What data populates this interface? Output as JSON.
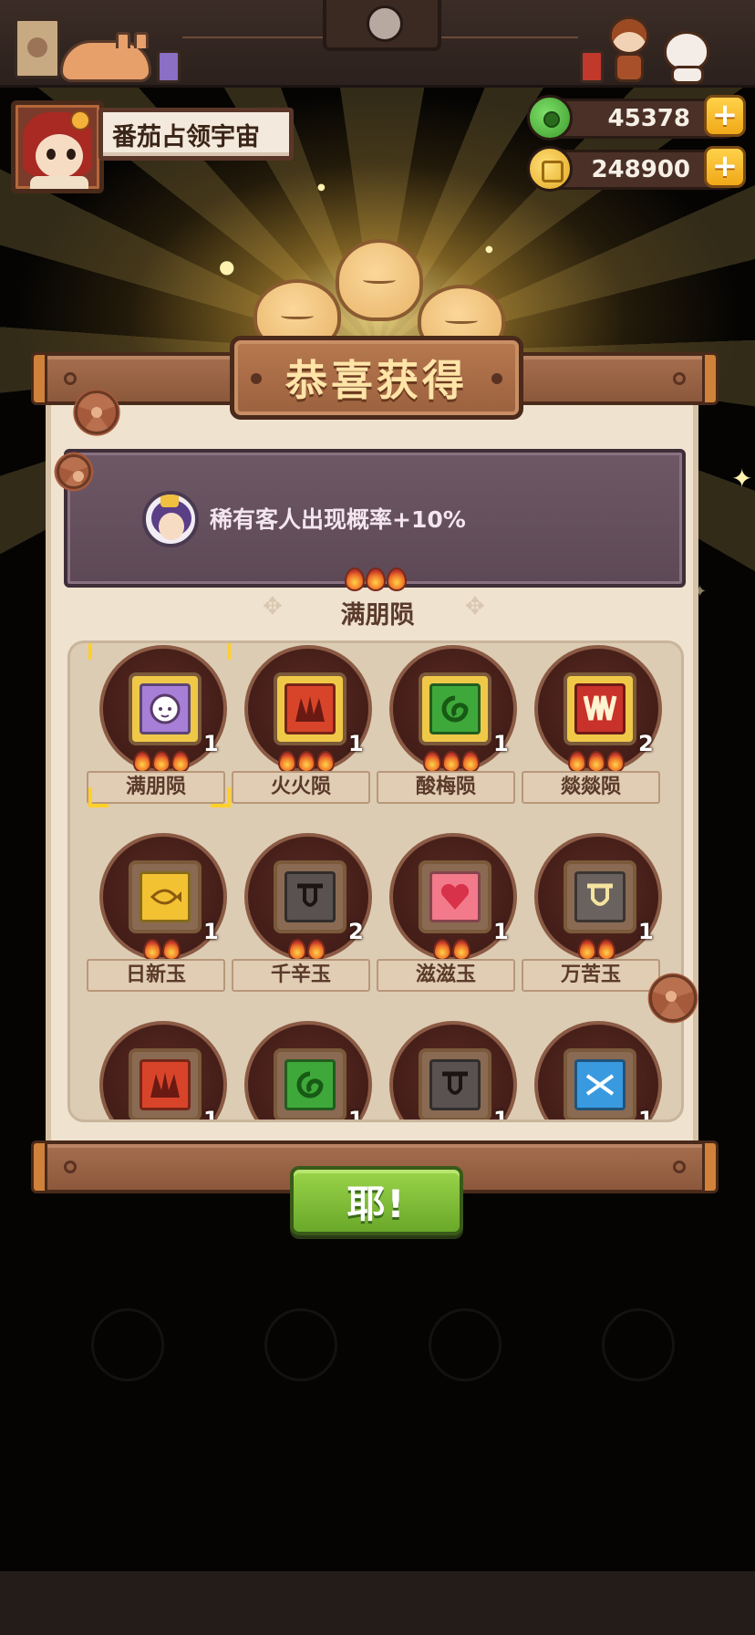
{
  "header": {
    "player_name": "番茄占领宇宙"
  },
  "currency": {
    "jade": "45378",
    "gold": "248900",
    "add_symbol": "+"
  },
  "popup": {
    "title": "恭喜获得",
    "bonus_text": "稀有客人出现概率+10%",
    "bonus_fire_count": 3,
    "set_name": "满朋陨",
    "confirm_label": "耶!"
  },
  "items": [
    {
      "name": "满朋陨",
      "count": "1",
      "fires": 3,
      "color": "#a77fd6",
      "tile": "#f0c848",
      "icon": "sheep-icon",
      "glyph": "",
      "selected": true
    },
    {
      "name": "火火陨",
      "count": "1",
      "fires": 3,
      "color": "#d8442a",
      "tile": "#f0c848",
      "icon": "flame-icon",
      "glyph": "",
      "selected": false
    },
    {
      "name": "酸梅陨",
      "count": "1",
      "fires": 3,
      "color": "#3fa83a",
      "tile": "#f0c848",
      "icon": "swirl-icon",
      "glyph": "",
      "selected": false
    },
    {
      "name": "燚燚陨",
      "count": "2",
      "fires": 3,
      "color": "#c8322a",
      "tile": "#f0c848",
      "icon": "crown-icon",
      "glyph": "",
      "selected": false
    },
    {
      "name": "日新玉",
      "count": "1",
      "fires": 2,
      "color": "#f3c232",
      "tile": "#8a6a52",
      "icon": "fish-icon",
      "glyph": "",
      "selected": false
    },
    {
      "name": "千辛玉",
      "count": "2",
      "fires": 2,
      "color": "#5a5250",
      "tile": "#8a6a52",
      "icon": "tongue-icon",
      "glyph": "",
      "selected": false
    },
    {
      "name": "滋滋玉",
      "count": "1",
      "fires": 2,
      "color": "#f27a8a",
      "tile": "#8a6a52",
      "icon": "heart-icon",
      "glyph": "",
      "selected": false
    },
    {
      "name": "万苦玉",
      "count": "1",
      "fires": 2,
      "color": "#6a625e",
      "tile": "#8a6a52",
      "icon": "bowl-icon",
      "glyph": "",
      "selected": false
    },
    {
      "name": "",
      "count": "1",
      "fires": 0,
      "color": "#d8442a",
      "tile": "#8a6a52",
      "icon": "flame-icon",
      "glyph": "",
      "selected": false
    },
    {
      "name": "",
      "count": "1",
      "fires": 0,
      "color": "#3fa83a",
      "tile": "#8a6a52",
      "icon": "swirl-icon",
      "glyph": "",
      "selected": false
    },
    {
      "name": "",
      "count": "1",
      "fires": 0,
      "color": "#5a5250",
      "tile": "#8a6a52",
      "icon": "tongue-icon",
      "glyph": "",
      "selected": false
    },
    {
      "name": "",
      "count": "1",
      "fires": 0,
      "color": "#3a9ae0",
      "tile": "#8a6a52",
      "icon": "bowtie-icon",
      "glyph": "",
      "selected": false
    }
  ]
}
